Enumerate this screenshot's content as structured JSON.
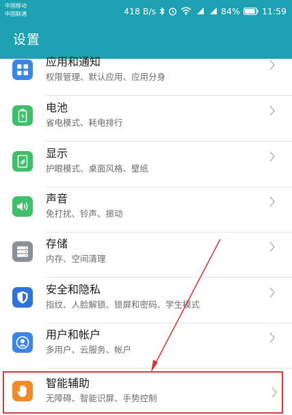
{
  "statusbar": {
    "carrier_1": "中国移动",
    "carrier_2": "中国联通",
    "speed": "418 B/s",
    "battery": "84%",
    "time": "11:59"
  },
  "header": {
    "title": "设置"
  },
  "items": [
    {
      "label": "应用和通知",
      "sub": "权限管理、默认应用、应用分身",
      "icon": "apps-grid-icon",
      "color": "#3a86e8"
    },
    {
      "label": "电池",
      "sub": "省电模式、耗电排行",
      "icon": "battery-icon",
      "color": "#3fbf6a"
    },
    {
      "label": "显示",
      "sub": "护眼模式、桌面风格、壁纸",
      "icon": "display-icon",
      "color": "#3fbf6a"
    },
    {
      "label": "声音",
      "sub": "免打扰、铃声、振动",
      "icon": "speaker-icon",
      "color": "#3fbf6a"
    },
    {
      "label": "存储",
      "sub": "内存、空间清理",
      "icon": "storage-icon",
      "color": "#8a8f98"
    },
    {
      "label": "安全和隐私",
      "sub": "指纹、人脸解锁、锁屏和密码、学生模式",
      "icon": "shield-icon",
      "color": "#2f73d9"
    },
    {
      "label": "用户和帐户",
      "sub": "多用户、云服务、帐户",
      "icon": "user-icon",
      "color": "#3a86e8"
    },
    {
      "label": "智能辅助",
      "sub": "无障碍、智能识屏、手势控制",
      "icon": "hand-icon",
      "color": "#f08a2a"
    }
  ],
  "colors": {
    "header": "#1ca1b2",
    "annotation": "#d23a3a"
  }
}
